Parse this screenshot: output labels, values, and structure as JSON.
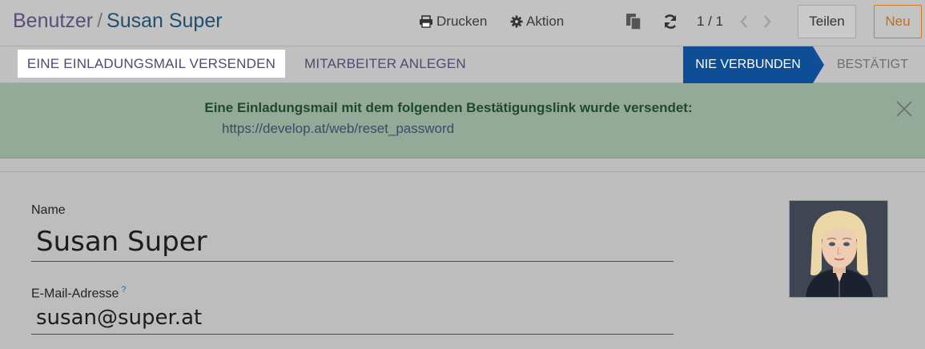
{
  "breadcrumb": {
    "parent": "Benutzer",
    "separator": "/",
    "current": "Susan Super"
  },
  "toolbar": {
    "print_label": "Drucken",
    "action_label": "Aktion",
    "pager_value": "1 / 1",
    "share_label": "Teilen",
    "new_label": "Neu"
  },
  "statusbar": {
    "invite_label": "EINE EINLADUNGSMAIL VERSENDEN",
    "create_employee_label": "MITARBEITER ANLEGEN",
    "stages": [
      {
        "label": "NIE VERBUNDEN",
        "active": true
      },
      {
        "label": "BESTÄTIGT",
        "active": false
      }
    ]
  },
  "alert": {
    "title": "Eine Einladungsmail mit dem folgenden Bestätigungslink wurde versendet:",
    "link": "https://develop.at/web/reset_password"
  },
  "form": {
    "name_label": "Name",
    "name_value": "Susan Super",
    "email_label": "E-Mail-Adresse",
    "email_help": "?",
    "email_value": "susan@super.at"
  },
  "colors": {
    "stage_active": "#0e4e96",
    "alert_bg": "#94aa99",
    "new_button": "#c56d11"
  },
  "icons": [
    "print-icon",
    "gear-icon",
    "duplicate-icon",
    "refresh-icon",
    "chevron-left-icon",
    "chevron-right-icon",
    "close-icon"
  ]
}
